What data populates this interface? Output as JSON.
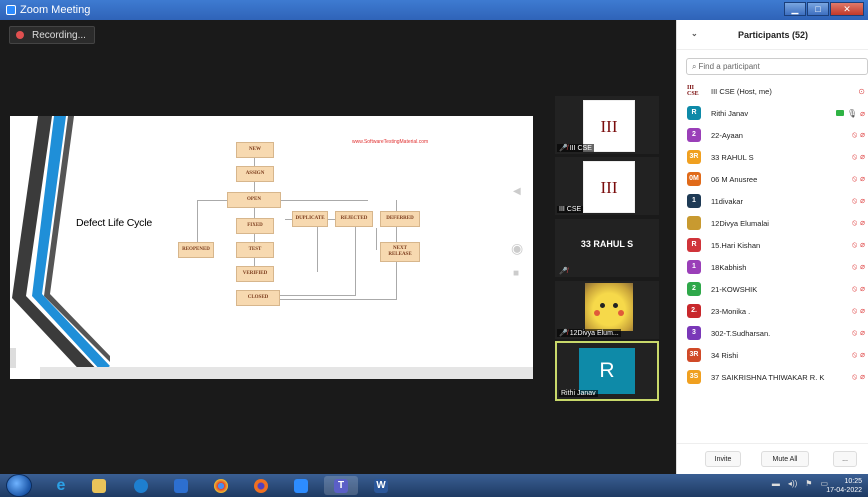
{
  "window": {
    "title": "Zoom Meeting"
  },
  "recording": {
    "label": "Recording..."
  },
  "slide": {
    "title": "Defect Life Cycle",
    "watermark": "www.SoftwareTestingMaterial.com",
    "states": {
      "new": "NEW",
      "assign": "ASSIGN",
      "open": "OPEN",
      "fixed": "FIXED",
      "test": "TEST",
      "verified": "VERIFIED",
      "closed": "CLOSED",
      "reopened": "REOPENED",
      "duplicate": "DUPLICATE",
      "rejected": "REJECTED",
      "deferred": "DEFERRED",
      "next_release": "NEXT RELEASE"
    }
  },
  "video_tiles": [
    {
      "name": "III CSE",
      "image_text": "III CSE",
      "muted": true
    },
    {
      "name": "III CSE",
      "image_text": "III CSE",
      "muted": false
    },
    {
      "name": "33 RAHUL S",
      "muted": true
    },
    {
      "name": "12Divya Elum...",
      "muted": true
    },
    {
      "name": "Rithi Janav",
      "avatar": "R",
      "speaking": true
    }
  ],
  "participants": {
    "title": "Participants (52)",
    "search_placeholder": "Find a participant",
    "host": {
      "avatar": "III CSE",
      "name": "III CSE (Host, me)"
    },
    "list": [
      {
        "avatar": "R",
        "name": "Rithi Janav",
        "color": "#0e8aa8"
      },
      {
        "avatar": "2",
        "name": "22-Ayaan",
        "color": "#9a3fb8"
      },
      {
        "avatar": "3R",
        "name": "33 RAHUL S",
        "color": "#f0a020"
      },
      {
        "avatar": "0M",
        "name": "06 M Anusree",
        "color": "#e06a1a"
      },
      {
        "avatar": "1",
        "name": "11divakar",
        "color": "#1e3a55"
      },
      {
        "avatar": "",
        "name": "12Divya Elumalai",
        "color": "#c89a30"
      },
      {
        "avatar": "R",
        "name": "15.Hari Kishan",
        "color": "#d0343a"
      },
      {
        "avatar": "1",
        "name": "18Kabhish",
        "color": "#9a3fb8"
      },
      {
        "avatar": "2",
        "name": "21-KOWSHIK",
        "color": "#2fa84a"
      },
      {
        "avatar": "2.",
        "name": "23-Monika .",
        "color": "#c8282c"
      },
      {
        "avatar": "3",
        "name": "302-T.Sudharsan.",
        "color": "#7a38b8"
      },
      {
        "avatar": "3R",
        "name": "34 Rishi",
        "color": "#d04a28"
      },
      {
        "avatar": "3S",
        "name": "37 SAIKRISHNA THIWAKAR R. K",
        "color": "#f0a020"
      }
    ],
    "invite_label": "Invite",
    "mute_all_label": "Mute All",
    "more_label": "..."
  },
  "taskbar": {
    "time": "10:25",
    "date": "17-04-2022"
  }
}
